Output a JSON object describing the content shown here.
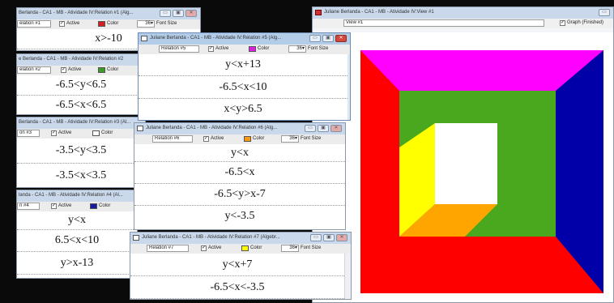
{
  "windows": {
    "r1": {
      "title": "Berlanda - CA1 - MB - Atividade IV:Relation #1 (Alg...",
      "name": "elation #1",
      "active": "Active",
      "color": "Color",
      "fontsize": "36",
      "fontsize_label": "Font Size",
      "rows": [
        "x>-10"
      ],
      "swatch": "#d62020"
    },
    "r2": {
      "title": "e Berlanda - CA1 - MB - Atividade IV:Relation #2",
      "name": "elation #2",
      "active": "Active",
      "color": "Color",
      "rows": [
        "-6.5<y<6.5",
        "-6.5<x<6.5"
      ],
      "swatch": "#3a9b28"
    },
    "r3": {
      "title": "Berlanda - CA1 - MB - Atividade IV:Relation #3 (Al...",
      "name": "on #3",
      "active": "Active",
      "color": "Color",
      "rows": [
        "-3.5<y<3.5",
        "-3.5<x<3.5"
      ],
      "swatch": "#ffffff"
    },
    "r4": {
      "title": "landa - CA1 - MB - Atividade IV:Relation #4 (Al...",
      "name": "n #4",
      "active": "Active",
      "color": "Color",
      "rows": [
        "y<x",
        "6.5<x<10",
        "y>x-13"
      ],
      "swatch": "#1a1aa0"
    },
    "r5": {
      "title": "Juliane Berlanda - CA1 - MB - Atividade IV:Relation #5 (Alg...",
      "name": "Relation #5",
      "active": "Active",
      "color": "Color",
      "fontsize": "36",
      "fontsize_label": "Font Size",
      "rows": [
        "y<x+13",
        "-6.5<x<10",
        "x<y>6.5"
      ],
      "swatch": "#e020e0"
    },
    "r6": {
      "title": "Juliane Berlanda - CA1 - MB - Atividade IV:Relation #6 (Alg...",
      "name": "Relation #6",
      "active": "Active",
      "color": "Color",
      "fontsize": "36",
      "fontsize_label": "Font Size",
      "rows": [
        "y<x",
        "-6.5<x",
        "-6.5<y>x-7",
        "y<-3.5"
      ],
      "swatch": "#ff9a10"
    },
    "r7": {
      "title": "Juliane Berlanda - CA1 - MB - Atividade IV:Relation #7 (Algebr...",
      "name": "Relation #7",
      "active": "Active",
      "color": "Color",
      "fontsize": "36",
      "fontsize_label": "Font Size",
      "rows": [
        "y<x+7",
        "-6.5<x<-3.5"
      ],
      "swatch": "#ffff00"
    },
    "view": {
      "title": "Juliane Berlanda - CA1 - MB - Atividade IV:View #1",
      "name": "View #1",
      "graph": "Graph (Finished)"
    }
  },
  "ctrl_glyphs": {
    "min": "▭",
    "max": "▣",
    "close": "✕"
  },
  "check_glyph": "✓",
  "dropdown_glyph": "▾",
  "colors": {
    "red": "#ff0000",
    "magenta": "#ff00ff",
    "blue": "#0000a8",
    "green": "#4aa81e",
    "yellow": "#ffff00",
    "orange": "#ffa500",
    "white": "#ffffff"
  }
}
